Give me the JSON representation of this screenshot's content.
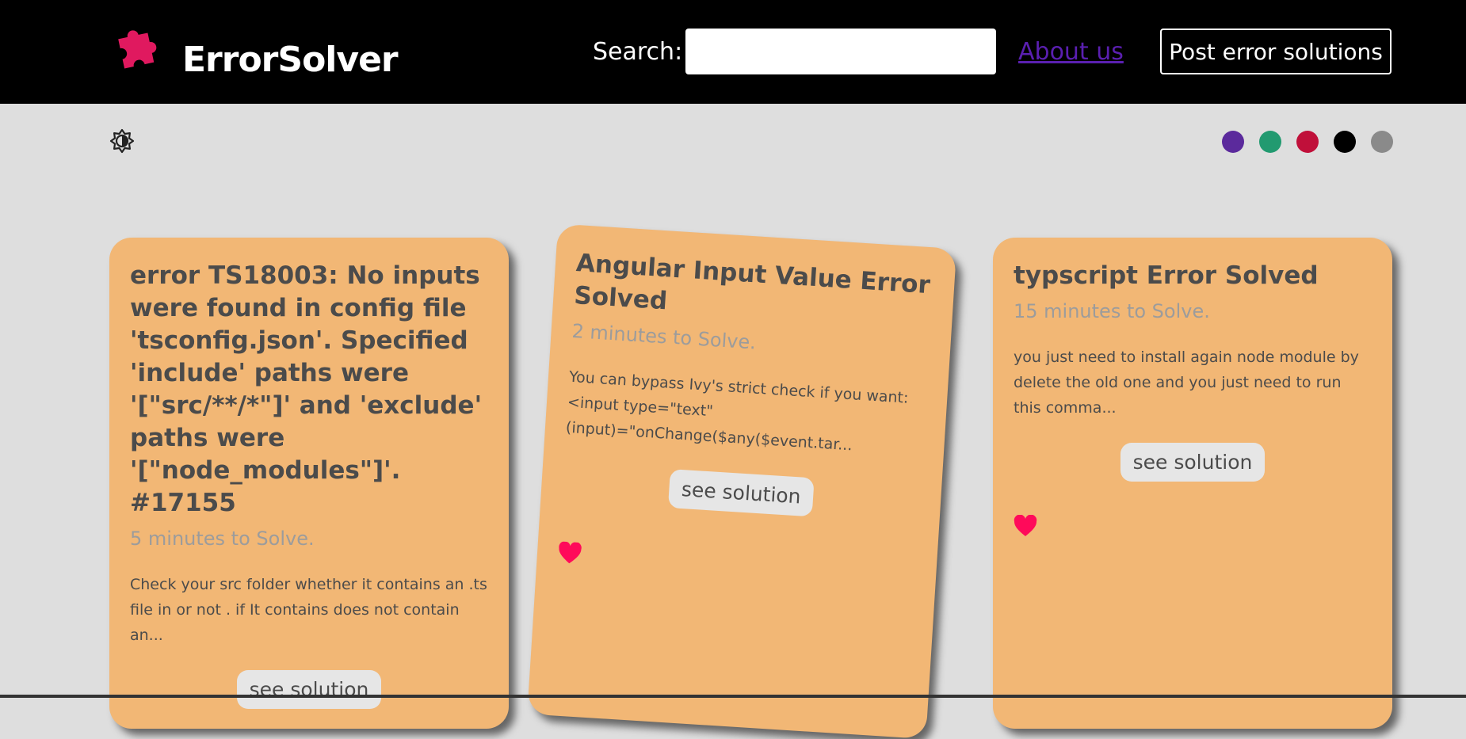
{
  "header": {
    "brand": "ErrorSolver",
    "search_label": "Search:",
    "search_value": "",
    "about_label": "About us",
    "post_label": "Post error solutions"
  },
  "theme": {
    "color_options": [
      "#5b2a9c",
      "#229a70",
      "#c0103a",
      "#000000",
      "#8a8a8a"
    ]
  },
  "cards": [
    {
      "title": "error TS18003: No inputs were found in config file 'tsconfig.json'. Specified 'include' paths were '[\"src/**/*\"]' and 'exclude' paths were '[\"node_modules\"]'. #17155",
      "time": "5 minutes to Solve.",
      "excerpt": "Check your src folder whether it contains an .ts file in or not . if It contains does not contain an...",
      "button": "see solution"
    },
    {
      "title": "Angular Input Value Error Solved",
      "time": "2 minutes to Solve.",
      "excerpt": "You can bypass Ivy's strict check if you want: <input type=\"text\" (input)=\"onChange($any($event.tar...",
      "button": "see solution"
    },
    {
      "title": "typscript Error Solved",
      "time": "15 minutes to Solve.",
      "excerpt": "you just need to install again node module by delete the old one and you just need to run this comma...",
      "button": "see solution"
    }
  ],
  "colors": {
    "header_bg": "#000000",
    "card_bg": "#f2b775",
    "heart": "#ff0a5a",
    "logo": "#e0195f"
  }
}
